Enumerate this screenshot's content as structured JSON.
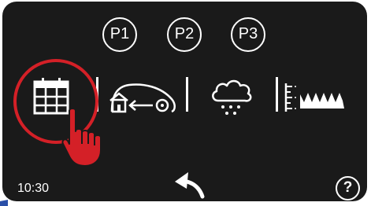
{
  "programs": [
    {
      "label": "P1"
    },
    {
      "label": "P2"
    },
    {
      "label": "P3"
    }
  ],
  "menu": [
    {
      "name": "schedule",
      "icon": "calendar-grid-icon"
    },
    {
      "name": "return-home",
      "icon": "mower-return-to-base-icon"
    },
    {
      "name": "rain",
      "icon": "rain-cloud-icon"
    },
    {
      "name": "cutting-height",
      "icon": "grass-height-icon"
    }
  ],
  "status": {
    "time": "10:30"
  },
  "help": {
    "label": "?"
  },
  "colors": {
    "screen": "#1a1a1a",
    "foreground": "#ffffff",
    "highlight": "#d42027"
  }
}
